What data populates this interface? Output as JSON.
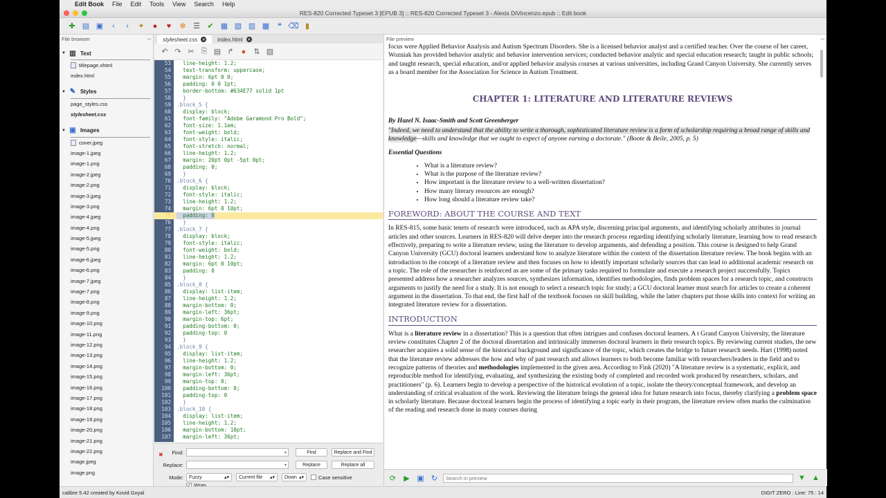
{
  "menubar": {
    "app": "Edit Book",
    "items": [
      "File",
      "Edit",
      "Tools",
      "View",
      "Search",
      "Help"
    ]
  },
  "window": {
    "title": "RES-820 Corrected Typeset 3 [EPUB 3] :: RES-820 Corrected Typeset 3 - Alexis DiVincenzo.epub :: Edit book"
  },
  "file_browser": {
    "title": "File browser",
    "sections": [
      {
        "label": "Text",
        "items": [
          "titlepage.xhtml",
          "index.html"
        ]
      },
      {
        "label": "Styles",
        "items": [
          "page_styles.css",
          "stylesheet.css"
        ]
      },
      {
        "label": "Images",
        "items": [
          "cover.jpeg",
          "image-1.jpeg",
          "image-1.png",
          "image-2.jpeg",
          "image-2.png",
          "image-3.jpeg",
          "image-3.png",
          "image-4.jpeg",
          "image-4.png",
          "image-5.jpeg",
          "image-5.png",
          "image-6.jpeg",
          "image-6.png",
          "image-7.jpeg",
          "image-7.png",
          "image-8.png",
          "image-9.png",
          "image-10.png",
          "image-11.png",
          "image-12.png",
          "image-13.png",
          "image-14.png",
          "image-15.png",
          "image-16.png",
          "image-17.png",
          "image-18.png",
          "image-19.png",
          "image-20.png",
          "image-21.png",
          "image-22.png",
          "image.jpeg",
          "image.png"
        ]
      }
    ]
  },
  "editor": {
    "tabs": [
      "stylesheet.css",
      "index.html"
    ],
    "lines": [
      [
        "53",
        "  line-height: 1.2;"
      ],
      [
        "54",
        "  text-transform: uppercase;"
      ],
      [
        "55",
        "  margin: 6pt 0 0;"
      ],
      [
        "56",
        "  padding: 0 0 1pt;"
      ],
      [
        "57",
        "  border-bottom: #634E77 solid 1pt"
      ],
      [
        "58",
        "  }"
      ],
      [
        "59",
        ".block_5 {"
      ],
      [
        "60",
        "  display: block;"
      ],
      [
        "61",
        "  font-family: \"Adobe Garamond Pro Bold\";"
      ],
      [
        "62",
        "  font-size: 1.1em;"
      ],
      [
        "63",
        "  font-weight: bold;"
      ],
      [
        "64",
        "  font-style: italic;"
      ],
      [
        "65",
        "  font-stretch: normal;"
      ],
      [
        "66",
        "  line-height: 1.2;"
      ],
      [
        "67",
        "  margin: 20pt 0pt -5pt 0pt;"
      ],
      [
        "68",
        "  padding: 0;"
      ],
      [
        "69",
        "  }"
      ],
      [
        "70",
        ".block_6 {"
      ],
      [
        "71",
        "  display: block;"
      ],
      [
        "72",
        "  font-style: italic;"
      ],
      [
        "73",
        "  line-height: 1.2;"
      ],
      [
        "74",
        "  margin: 6pt 0 10pt;"
      ],
      [
        "75",
        "  padding: 0"
      ],
      [
        "76",
        "  }"
      ],
      [
        "77",
        ".block_7 {"
      ],
      [
        "78",
        "  display: block;"
      ],
      [
        "79",
        "  font-style: italic;"
      ],
      [
        "80",
        "  font-weight: bold;"
      ],
      [
        "81",
        "  line-height: 1.2;"
      ],
      [
        "82",
        "  margin: 6pt 0 10pt;"
      ],
      [
        "83",
        "  padding: 0"
      ],
      [
        "84",
        "  }"
      ],
      [
        "85",
        ".block_8 {"
      ],
      [
        "86",
        "  display: list-item;"
      ],
      [
        "87",
        "  line-height: 1.2;"
      ],
      [
        "88",
        "  margin-bottom: 0;"
      ],
      [
        "89",
        "  margin-left: 36pt;"
      ],
      [
        "90",
        "  margin-top: 6pt;"
      ],
      [
        "91",
        "  padding-bottom: 0;"
      ],
      [
        "92",
        "  padding-top: 0"
      ],
      [
        "93",
        "  }"
      ],
      [
        "94",
        ".block_9 {"
      ],
      [
        "95",
        "  display: list-item;"
      ],
      [
        "96",
        "  line-height: 1.2;"
      ],
      [
        "97",
        "  margin-bottom: 0;"
      ],
      [
        "98",
        "  margin-left: 36pt;"
      ],
      [
        "99",
        "  margin-top: 0;"
      ],
      [
        "100",
        "  padding-bottom: 0;"
      ],
      [
        "101",
        "  padding-top: 0"
      ],
      [
        "102",
        "  }"
      ],
      [
        "103",
        ".block_10 {"
      ],
      [
        "104",
        "  display: list-item;"
      ],
      [
        "105",
        "  line-height: 1.2;"
      ],
      [
        "106",
        "  margin-bottom: 10pt;"
      ],
      [
        "107",
        "  margin-left: 36pt;"
      ]
    ],
    "current_line": "75"
  },
  "find": {
    "find_label": "Find:",
    "replace_label": "Replace:",
    "mode_label": "Mode:",
    "find_btn": "Find",
    "replace_find_btn": "Replace and Find",
    "replace_btn": "Replace",
    "replace_all_btn": "Replace all",
    "mode_value": "Fuzzy",
    "scope_value": "Current file",
    "direction_value": "Down",
    "case_label": "Case sensitive",
    "wrap_label": "Wrap"
  },
  "preview": {
    "title": "File preview",
    "intro": "focus were Applied Behavior Analysis and Autism Spectrum Disorders. She is a licensed behavior analyst and a certified teacher. Over the course of her career, Wozniak has provided behavior analytic and behavior intervention services; conducted behavior analytic and special education research; taught in public schools; and taught research, special education, and/or applied behavior analysis courses at various universities, including Grand Canyon University. She currently serves as a board member for the Association for Science in Autism Treatment.",
    "chapter": "CHAPTER 1: LITERATURE AND LITERATURE REVIEWS",
    "authors": "By Hazel N. Isaac-Smith and Scott Greenberger",
    "quote_a": "\"Indeed, we need to understand that the ability to write a thorough, sophisticated literature review is a form of scholarship requiring a broad range of skills and knowledge",
    "quote_b": "—skills and knowledge that we ought to expect of anyone earning a doctorate.\" (Boote & Beile, 2005, p. 5)",
    "eq_title": "Essential Questions",
    "questions": [
      "What is a literature review?",
      "What is the purpose of the literature review?",
      "How important is the literature review to a well-written dissertation?",
      "How many literary resources are enough?",
      "How long should a literature review take?"
    ],
    "foreword_title": "FOREWORD: ABOUT THE COURSE AND TEXT",
    "foreword": "In RES-815, some basic tenets of research were introduced, such as APA style, discerning principal arguments, and identifying scholarly attributes in journal articles and other sources. Learners in RES-820 will delve deeper into the research process regarding identifying scholarly literature, learning how to read research effectively, preparing to write a literature review, using the literature to develop arguments, and defending a position. This course is designed to help Grand Canyon University (GCU) doctoral learners understand how to analyze literature within the context of the dissertation literature review. The book begins with an introduction to the concept of a literature review and then focuses on how to identify important scholarly sources that can lead to additional academic research on a topic. The role of the researcher is reinforced as are some of the primary tasks required to formulate and execute a research project successfully. Topics presented address how a researcher analyzes sources, synthesizes information, identifies methodologies, finds problem spaces for a research topic, and constructs arguments to justify the need for a study. It is not enough to select a research topic for study; a GCU doctoral learner must search for articles to create a coherent argument in the dissertation. To that end, the first half of the textbook focuses on skill building, while the latter chapters put those skills into context for writing an integrated literature review for a dissertation.",
    "intro_title": "INTRODUCTION",
    "intro_p1": "What is a ",
    "intro_b1": "literature review",
    "intro_p2": " in a dissertation? This is a question that often intrigues and confuses doctoral learners. A t Grand Canyon University, the literature review constitutes Chapter 2 of the doctoral dissertation and intrinsically immerses doctoral learners in their research topics. By reviewing current studies, the new researcher acquires a solid sense of the historical background and significance of the topic, which creates the bridge to future research needs. Hart (1998) noted that the literature review addresses the how and why of past research and allows learners to both become familiar with researchers/leaders in the field and to recognize patterns of theories and ",
    "intro_b2": "methodologies",
    "intro_p3": " implemented in the given area. According to Fink (2020) \"A literature review is a systematic, explicit, and reproducible method for identifying, evaluating, and synthesizing the existing body of completed and recorded work produced by researchers, scholars, and practitioners\" (p. 6). Learners begin to develop a perspective of the historical evolution of a topic, isolate the theory/conceptual framework, and develop an understanding of critical evaluation of the work. Reviewing the literature brings the general idea for future research into focus, thereby clarifying a ",
    "intro_b3": "problem space",
    "intro_p4": " in scholarly literature. Because doctoral learners begin the process of identifying a topic early in their program, the literature review often marks the culmination of the reading and research done in many courses during",
    "search_placeholder": "Search in preview"
  },
  "status": {
    "left": "calibre 5.42 created by Kovid Goyal",
    "right": "DIGIT ZERO : Line: 75 : 14"
  }
}
